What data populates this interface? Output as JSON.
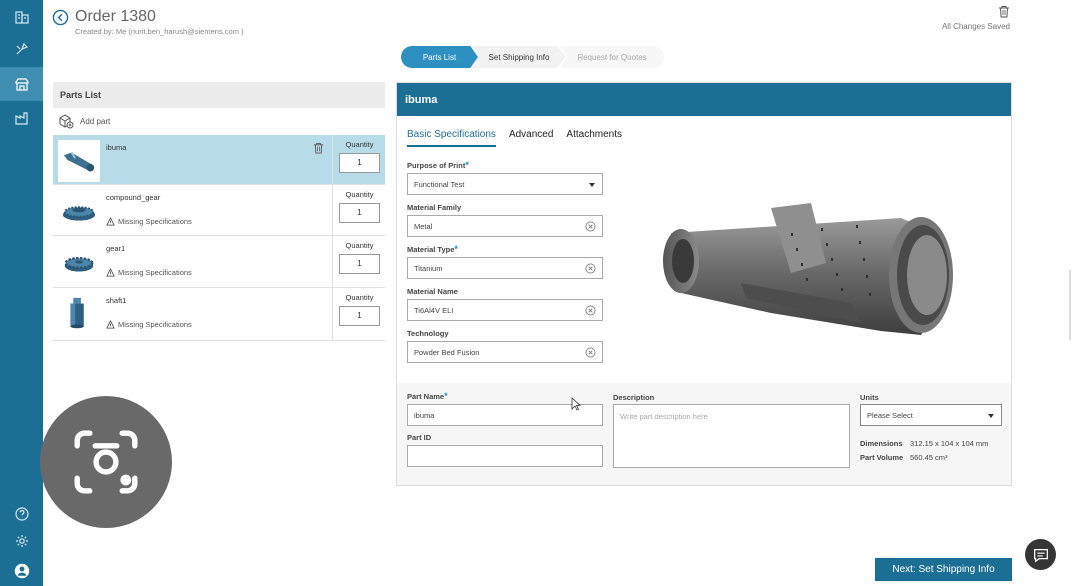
{
  "header": {
    "title": "Order 1380",
    "created_by": "Created by: Me (nurit.ben_harush@siemens.com )",
    "saved_status": "All Changes Saved"
  },
  "stepper": {
    "steps": [
      "Parts List",
      "Set Shipping Info",
      "Request for Quotes"
    ],
    "active": 0
  },
  "parts_panel": {
    "title": "Parts List",
    "add_label": "Add part",
    "qty_label": "Quantity",
    "parts": [
      {
        "name": "ibuma",
        "qty": "1",
        "warning": "",
        "selected": true
      },
      {
        "name": "compound_gear",
        "qty": "1",
        "warning": "Missing Specifications",
        "selected": false
      },
      {
        "name": "gear1",
        "qty": "1",
        "warning": "Missing Specifications",
        "selected": false
      },
      {
        "name": "shaft1",
        "qty": "1",
        "warning": "Missing Specifications",
        "selected": false
      }
    ]
  },
  "detail": {
    "title": "ibuma",
    "tabs": [
      "Basic Specifications",
      "Advanced",
      "Attachments"
    ],
    "purpose_label": "Purpose of Print",
    "purpose_value": "Functional Test",
    "family_label": "Material Family",
    "family_value": "Metal",
    "type_label": "Material Type",
    "type_value": "Titanium",
    "name_label": "Material Name",
    "name_value": "Ti6Al4V ELI",
    "tech_label": "Technology",
    "tech_value": "Powder Bed Fusion",
    "part_name_label": "Part Name",
    "part_name_value": "ibuma",
    "part_id_label": "Part ID",
    "part_id_value": "",
    "desc_label": "Description",
    "desc_placeholder": "Write part description here",
    "units_label": "Units",
    "units_value": "Please Select",
    "dim_label": "Dimensions",
    "dim_value": "312.15 x 104 x 104 mm",
    "vol_label": "Part Volume",
    "vol_value": "560.45 cm³"
  },
  "next_button": "Next: Set Shipping Info",
  "colors": {
    "brand": "#1c6f94",
    "step_active": "#2e8fc1",
    "selected_row": "#b7dbe9"
  }
}
